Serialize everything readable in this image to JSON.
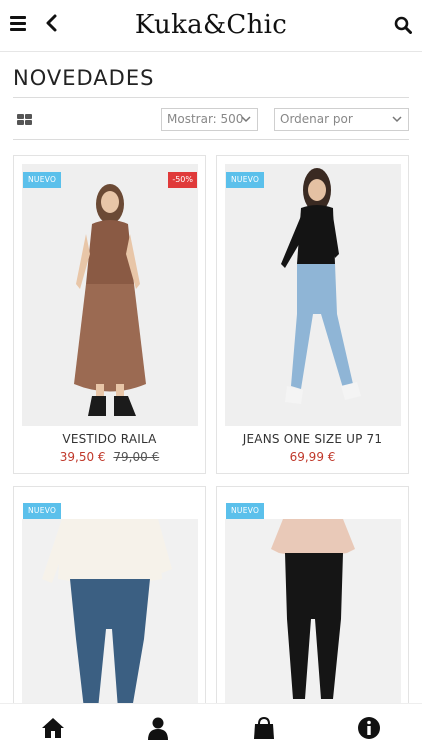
{
  "header": {
    "logo": "Kuka&Chic"
  },
  "page": {
    "title": "NOVEDADES"
  },
  "toolbar": {
    "view_icon": "grid-view-icon",
    "show_select": {
      "value": "Mostrar: 500"
    },
    "sort_select": {
      "value": "Ordenar por"
    }
  },
  "products": [
    {
      "name": "VESTIDO RAILA",
      "badge": "NUEVO",
      "discount": "-50%",
      "price": "39,50 €",
      "old_price": "79,00 €"
    },
    {
      "name": "JEANS ONE SIZE UP 71",
      "badge": "NUEVO",
      "price": "69,99 €"
    },
    {
      "name": "",
      "badge": "NUEVO"
    },
    {
      "name": "",
      "badge": "NUEVO"
    }
  ],
  "bottom_nav": {
    "items": [
      "home-icon",
      "user-icon",
      "shopping-bag-icon",
      "info-icon"
    ]
  },
  "colors": {
    "accent_new": "#5bc0eb",
    "sale_badge": "#e03a3a",
    "price": "#c0392b"
  }
}
